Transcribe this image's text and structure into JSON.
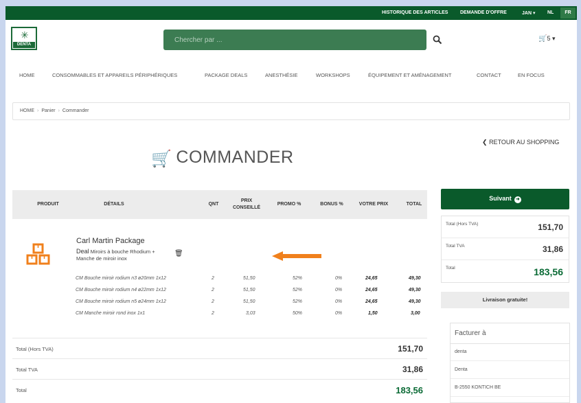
{
  "topbar": {
    "history": "HISTORIQUE DES ARTICLES",
    "quote": "DEMANDE D'OFFRE",
    "user": "JAN",
    "lang_nl": "NL",
    "lang_fr": "FR"
  },
  "header": {
    "logo_text": "DENTA",
    "search_placeholder": "Chercher par ...",
    "cart_count": "5"
  },
  "nav": [
    "HOME",
    "CONSOMMABLES ET APPAREILS PÉRIPHÉRIQUES",
    "PACKAGE DEALS",
    "ANESTHÉSIE",
    "WORKSHOPS",
    "ÉQUIPEMENT ET AMÉNAGEMENT",
    "CONTACT",
    "EN FOCUS"
  ],
  "breadcrumb": [
    "HOME",
    "Panier",
    "Commander"
  ],
  "page": {
    "title": "COMMANDER",
    "back": "RETOUR AU SHOPPING"
  },
  "table": {
    "headers": [
      "PRODUIT",
      "DÉTAILS",
      "QNT",
      "PRIX CONSEILLÉ",
      "PROMO %",
      "BONUS %",
      "VOTRE PRIX",
      "TOTAL"
    ],
    "product": {
      "title": "Carl Martin Package",
      "deal": "Deal",
      "desc": "Miroirs à bouche Rhodium + Manche de miroir inox"
    },
    "rows": [
      {
        "name": "CM Bouche miroir rodium n3 ø20mm 1x12",
        "qty": "2",
        "price": "51,50",
        "promo": "52%",
        "bonus": "0%",
        "yours": "24,65",
        "total": "49,30"
      },
      {
        "name": "CM Bouche miroir rodium n4 ø22mm 1x12",
        "qty": "2",
        "price": "51,50",
        "promo": "52%",
        "bonus": "0%",
        "yours": "24,65",
        "total": "49,30"
      },
      {
        "name": "CM Bouche miroir rodium n5 ø24mm 1x12",
        "qty": "2",
        "price": "51,50",
        "promo": "52%",
        "bonus": "0%",
        "yours": "24,65",
        "total": "49,30"
      },
      {
        "name": "CM Manche miroir rond inox 1x1",
        "qty": "2",
        "price": "3,03",
        "promo": "50%",
        "bonus": "0%",
        "yours": "1,50",
        "total": "3,00"
      }
    ]
  },
  "summary": {
    "excl_label": "Total (Hors TVA)",
    "excl_value": "151,70",
    "vat_label": "Total TVA",
    "vat_value": "31,86",
    "total_label": "Total",
    "total_value": "183,56"
  },
  "side": {
    "next_label": "Suivant",
    "excl_label": "Total (Hors TVA)",
    "excl_value": "151,70",
    "vat_label": "Total TVA",
    "vat_value": "31,86",
    "total_label": "Total",
    "total_value": "183,56",
    "free_delivery": "Livraison gratuite!",
    "bill_title": "Facturer à",
    "bill_lines": [
      "denta",
      "Denta",
      "B-2550 KONTICH BE"
    ]
  },
  "colors": {
    "brand_green": "#0a5a2b",
    "search_green": "#3c7c52",
    "accent_orange": "#f0801c"
  }
}
